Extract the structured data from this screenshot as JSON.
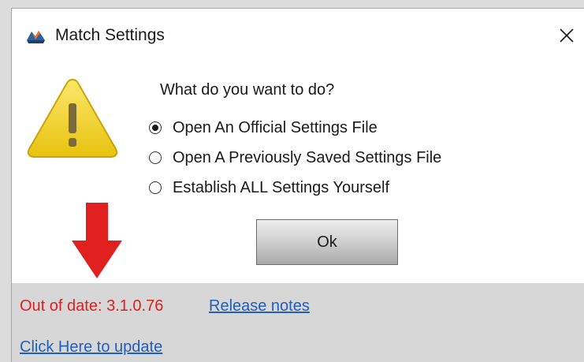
{
  "window": {
    "title": "Match Settings",
    "app_icon": "app-logo-icon",
    "close_icon": "close-icon"
  },
  "dialog": {
    "warning_icon": "warning-icon",
    "question": "What do you want to do?",
    "options": [
      {
        "label": "Open An Official Settings File",
        "selected": true
      },
      {
        "label": "Open A Previously Saved Settings File",
        "selected": false
      },
      {
        "label": "Establish ALL Settings Yourself",
        "selected": false
      }
    ],
    "ok_label": "Ok"
  },
  "annotation": {
    "arrow_icon": "red-down-arrow-icon",
    "color": "#e01f1f"
  },
  "footer": {
    "status": "Out of date: 3.1.0.76",
    "release_notes_link": "Release notes",
    "update_link": "Click Here to update"
  },
  "colors": {
    "status_red": "#e01f1f",
    "link_blue": "#1e5fbf",
    "footer_bg": "#d7d7d7",
    "warning_yellow": "#f2d21b"
  }
}
